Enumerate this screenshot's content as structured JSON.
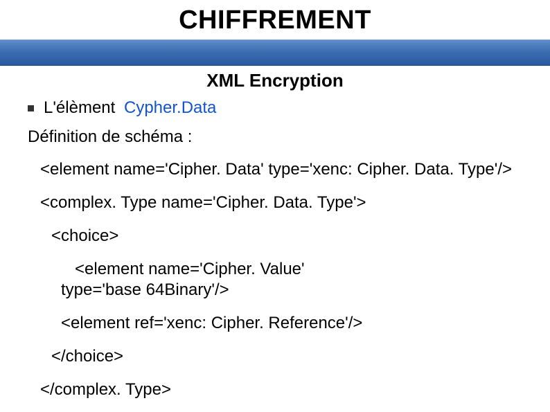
{
  "title": "CHIFFREMENT",
  "subtitle": "XML Encryption",
  "bullet": {
    "prefix": "L'élèment",
    "highlight": "Cypher.Data"
  },
  "definition": "Définition de schéma :",
  "code": {
    "l1": "<element name='Cipher. Data' type='xenc: Cipher. Data. Type'/>",
    "l2": "<complex. Type name='Cipher. Data. Type'>",
    "l3": "<choice>",
    "l4": "<element name='Cipher. Value' type='base 64Binary'/>",
    "l5": "<element ref='xenc: Cipher. Reference'/>",
    "l6": "</choice>",
    "l7": "</complex. Type>"
  }
}
